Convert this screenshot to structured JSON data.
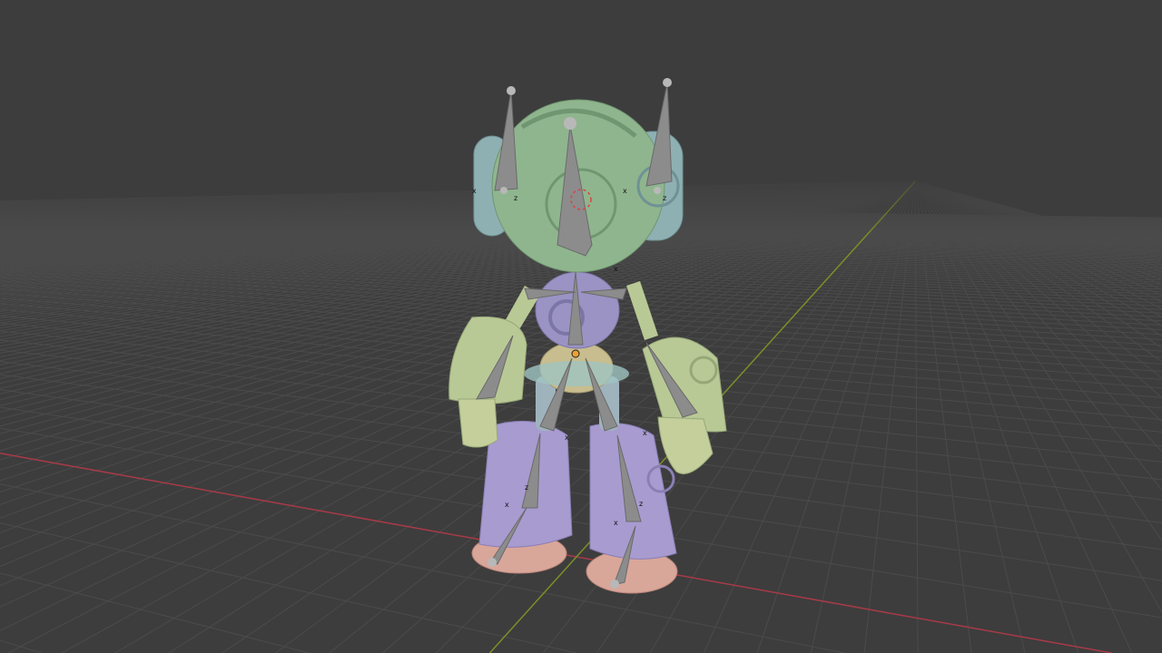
{
  "viewport": {
    "background": "#3d3d3d",
    "grid_color": "#4b4b4b",
    "x_axis_color": "#a83a48",
    "y_axis_color": "#7a8f28"
  },
  "colors": {
    "head": "#8fb58e",
    "ear": "#8fb0b3",
    "torso": "#9a93c4",
    "pelvis": "#c8bd8e",
    "arm": "#b9c995",
    "leg": "#a89bd0",
    "foot": "#d9a69a",
    "bone": "#8c8c8c"
  },
  "bone_axis_labels": {
    "x": "x",
    "z": "z"
  }
}
